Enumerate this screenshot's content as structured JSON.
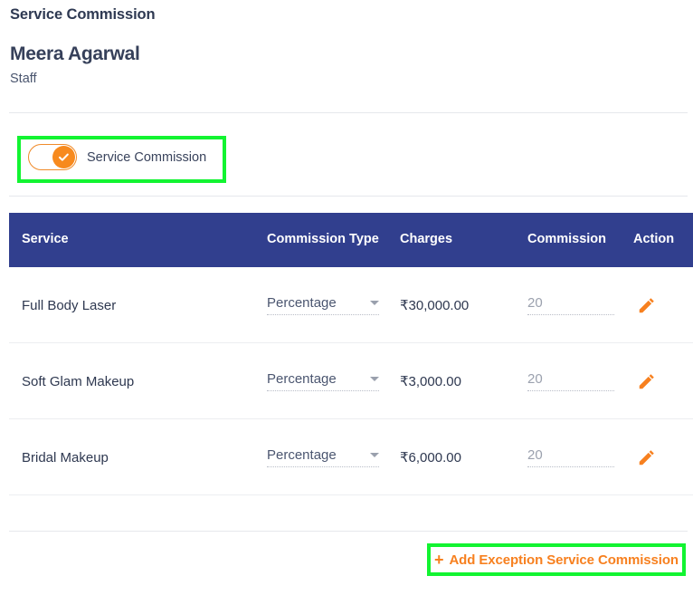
{
  "header": {
    "section_title": "Service Commission",
    "staff_name": "Meera Agarwal",
    "staff_role": "Staff"
  },
  "toggle": {
    "label": "Service Commission",
    "state": "on",
    "icon": "check-icon",
    "highlight_color": "#12f431",
    "accent_color": "#f78a1e"
  },
  "table": {
    "header_bg": "#313f8e",
    "columns": {
      "service": "Service",
      "commission_type": "Commission Type",
      "charges": "Charges",
      "commission": "Commission",
      "action": "Action"
    },
    "rows": [
      {
        "service": "Full Body Laser",
        "commission_type": "Percentage",
        "charges": "₹30,000.00",
        "commission": "20",
        "action_icon": "pencil-icon"
      },
      {
        "service": "Soft Glam Makeup",
        "commission_type": "Percentage",
        "charges": "₹3,000.00",
        "commission": "20",
        "action_icon": "pencil-icon"
      },
      {
        "service": "Bridal Makeup",
        "commission_type": "Percentage",
        "charges": "₹6,000.00",
        "commission": "20",
        "action_icon": "pencil-icon"
      }
    ]
  },
  "footer": {
    "add_button_plus": "+",
    "add_button_label": "Add Exception Service Commission",
    "accent_color": "#f7801f",
    "highlight_color": "#12f431"
  }
}
